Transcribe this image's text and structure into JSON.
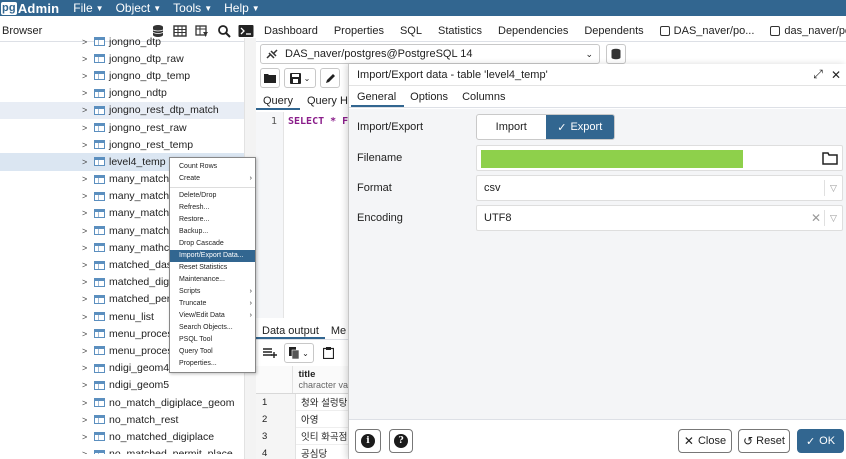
{
  "app": {
    "logo_pg": "pg",
    "logo_admin": "Admin"
  },
  "nav": {
    "file": "File",
    "object": "Object",
    "tools": "Tools",
    "help": "Help"
  },
  "browser": {
    "title": "Browser"
  },
  "tabs": [
    "Dashboard",
    "Properties",
    "SQL",
    "Statistics",
    "Dependencies",
    "Dependents",
    "DAS_naver/po...",
    "das_naver/pcw..."
  ],
  "connection": {
    "value": "DAS_naver/postgres@PostgreSQL 14"
  },
  "query_tabs": {
    "query": "Query",
    "history": "Query His"
  },
  "editor": {
    "line": "1",
    "code": "SELECT * F"
  },
  "output_tabs": {
    "data_output": "Data output",
    "messages": "Me"
  },
  "grid": {
    "header_title": "title",
    "header_type": "character va",
    "rows": [
      {
        "n": "1",
        "v": "청와 설렁탕"
      },
      {
        "n": "2",
        "v": "아영"
      },
      {
        "n": "3",
        "v": "잇티 화곡점"
      },
      {
        "n": "4",
        "v": "공심당"
      }
    ]
  },
  "tree": [
    {
      "label": "jongno_dtp"
    },
    {
      "label": "jongno_dtp_raw"
    },
    {
      "label": "jongno_dtp_temp"
    },
    {
      "label": "jongno_ndtp"
    },
    {
      "label": "jongno_rest_dtp_match"
    },
    {
      "label": "jongno_rest_raw"
    },
    {
      "label": "jongno_rest_temp"
    },
    {
      "label": "level4_temp"
    },
    {
      "label": "many_matche"
    },
    {
      "label": "many_matche"
    },
    {
      "label": "many_matche"
    },
    {
      "label": "many_matche"
    },
    {
      "label": "many_mathce"
    },
    {
      "label": "matched_das_"
    },
    {
      "label": "matched_digi"
    },
    {
      "label": "matched_pern"
    },
    {
      "label": "menu_list"
    },
    {
      "label": "menu_process"
    },
    {
      "label": "menu_process"
    },
    {
      "label": "ndigi_geom4"
    },
    {
      "label": "ndigi_geom5"
    },
    {
      "label": "no_match_digiplace_geom"
    },
    {
      "label": "no_match_rest"
    },
    {
      "label": "no_matched_digiplace"
    },
    {
      "label": "no_matched_permit_place"
    }
  ],
  "context_menu": [
    {
      "label": "Count Rows",
      "sub": false
    },
    {
      "label": "Create",
      "sub": true
    },
    {
      "sep": true
    },
    {
      "label": "Delete/Drop",
      "sub": false
    },
    {
      "label": "Refresh...",
      "sub": false
    },
    {
      "label": "Restore...",
      "sub": false
    },
    {
      "label": "Backup...",
      "sub": false
    },
    {
      "label": "Drop Cascade",
      "sub": false
    },
    {
      "label": "Import/Export Data...",
      "sub": false,
      "active": true
    },
    {
      "label": "Reset Statistics",
      "sub": false
    },
    {
      "label": "Maintenance...",
      "sub": false
    },
    {
      "label": "Scripts",
      "sub": true
    },
    {
      "label": "Truncate",
      "sub": true
    },
    {
      "label": "View/Edit Data",
      "sub": true
    },
    {
      "label": "Search Objects...",
      "sub": false
    },
    {
      "label": "PSQL Tool",
      "sub": false
    },
    {
      "label": "Query Tool",
      "sub": false
    },
    {
      "label": "Properties...",
      "sub": false
    }
  ],
  "dialog": {
    "title": "Import/Export data - table 'level4_temp'",
    "tabs": {
      "general": "General",
      "options": "Options",
      "columns": "Columns"
    },
    "fields": {
      "import_export_label": "Import/Export",
      "import_option": "Import",
      "export_option": "Export",
      "selected": "Export",
      "filename_label": "Filename",
      "filename_value": "",
      "format_label": "Format",
      "format_value": "csv",
      "encoding_label": "Encoding",
      "encoding_value": "UTF8"
    },
    "footer": {
      "close": "Close",
      "reset": "Reset",
      "ok": "OK"
    }
  },
  "colors": {
    "brand": "#326690",
    "progress": "#8ed04b"
  }
}
